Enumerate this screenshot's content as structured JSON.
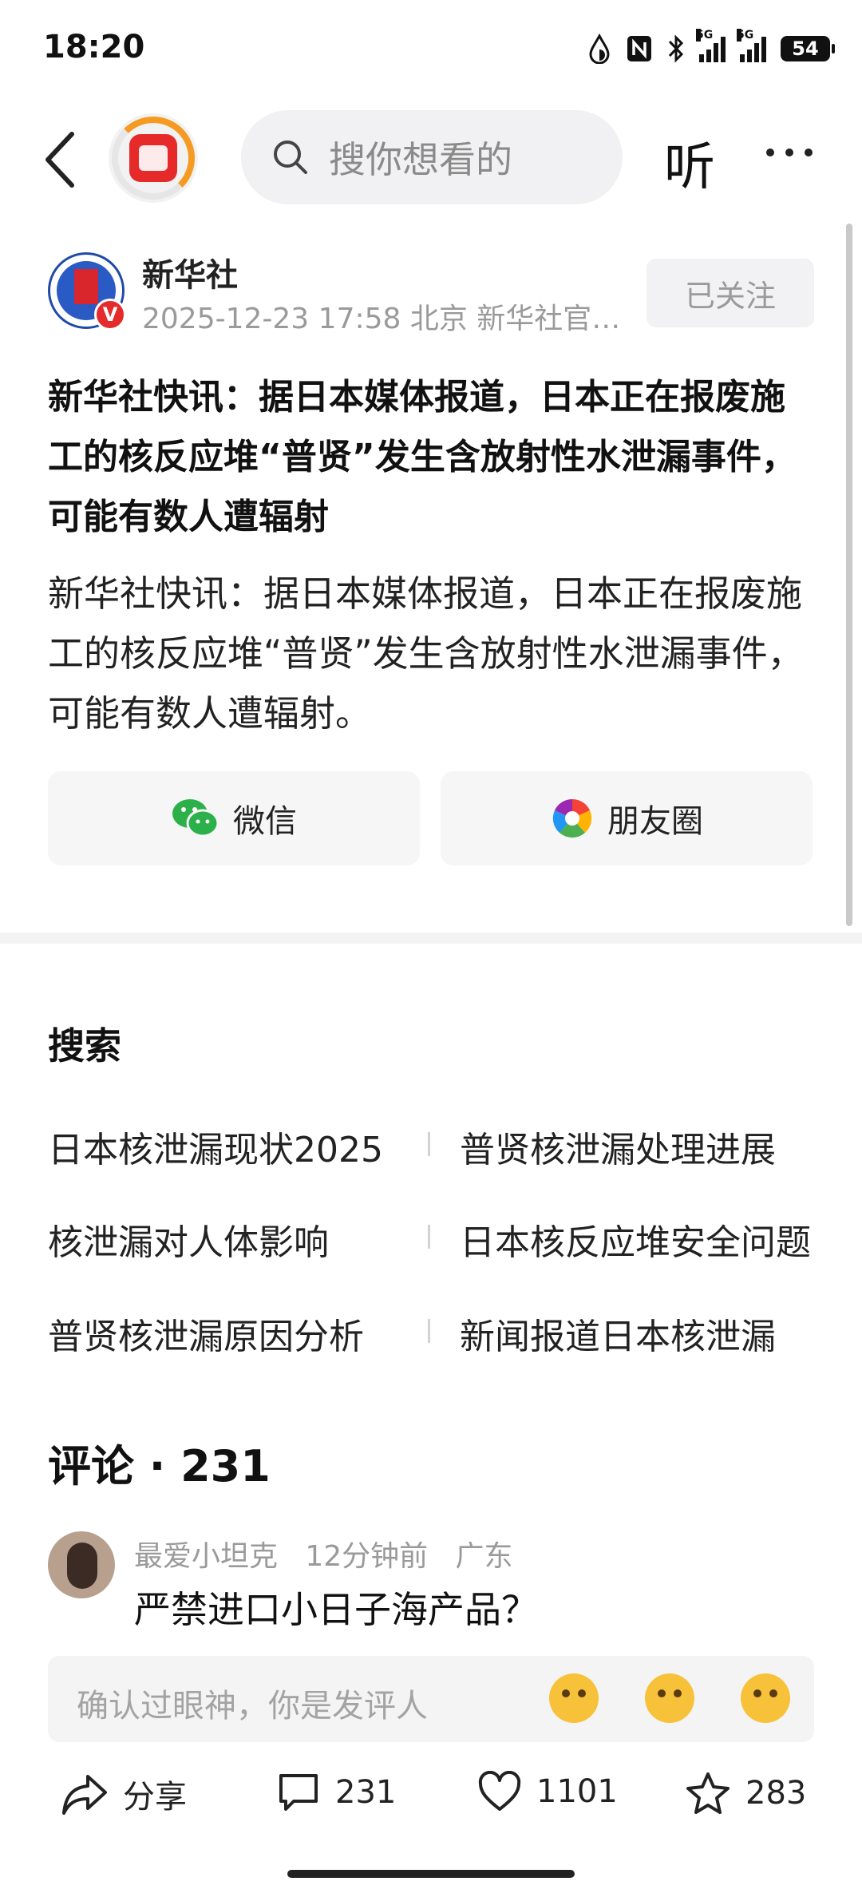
{
  "status_bar": {
    "time": "18:20",
    "battery": "54",
    "network_1": "5G",
    "network_2": "5G"
  },
  "nav": {
    "search_placeholder": "搜你想看的",
    "listen_label": "听"
  },
  "author": {
    "name": "新华社",
    "meta": "2025-12-23  17:58  北京  新华社官方...",
    "badge": "V",
    "follow_label": "已关注"
  },
  "article": {
    "title": "新华社快讯：据日本媒体报道，日本正在报废施工的核反应堆“普贤”发生含放射性水泄漏事件，可能有数人遭辐射",
    "body": "新华社快讯：据日本媒体报道，日本正在报废施工的核反应堆“普贤”发生含放射性水泄漏事件，可能有数人遭辐射。"
  },
  "share": {
    "wechat_label": "微信",
    "moments_label": "朋友圈"
  },
  "search": {
    "title": "搜索",
    "items": [
      "日本核泄漏现状2025",
      "普贤核泄漏处理进展",
      "核泄漏对人体影响",
      "日本核反应堆安全问题",
      "普贤核泄漏原因分析",
      "新闻报道日本核泄漏"
    ]
  },
  "comments": {
    "title": "评论 · 231",
    "first": {
      "user": "最爱小坦克",
      "time": "12分钟前",
      "region": "广东",
      "text": "严禁进口小日子海产品？"
    },
    "input_placeholder": "确认过眼神，你是发评人"
  },
  "actions": {
    "share_label": "分享",
    "comment_count": "231",
    "like_count": "1101",
    "favorite_count": "283"
  }
}
